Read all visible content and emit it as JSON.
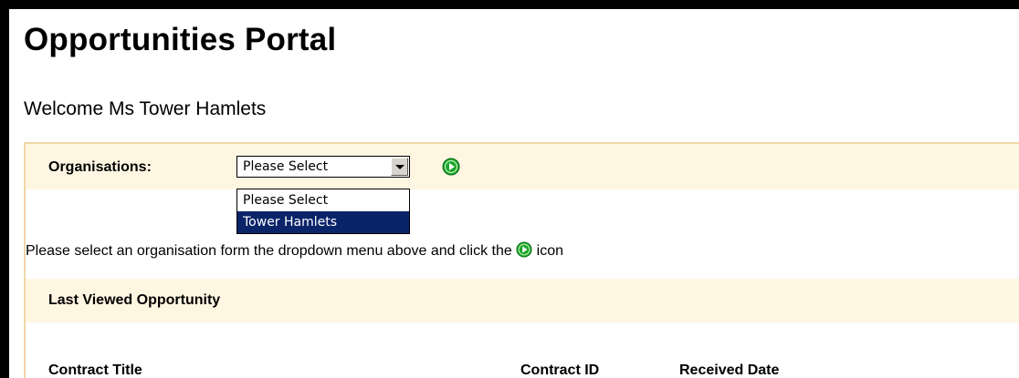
{
  "header": {
    "title": "Opportunities Portal",
    "welcome": "Welcome Ms Tower Hamlets"
  },
  "organisations": {
    "label": "Organisations:",
    "selected": "Please Select",
    "options": [
      "Please Select",
      "Tower Hamlets"
    ],
    "highlighted_index": 1
  },
  "instruction": {
    "before_icon": "Please select an organisation form the dropdown menu above and click the ",
    "after_icon": " icon"
  },
  "last_viewed": {
    "title": "Last Viewed Opportunity",
    "columns": [
      "Contract Title",
      "Contract ID",
      "Received Date"
    ]
  },
  "icons": {
    "go": "green-play-icon"
  },
  "colors": {
    "panel_bg": "#fff6e2",
    "panel_border": "#f0d6a8",
    "highlight": "#0a246a",
    "go_icon": "#1aa52a"
  }
}
